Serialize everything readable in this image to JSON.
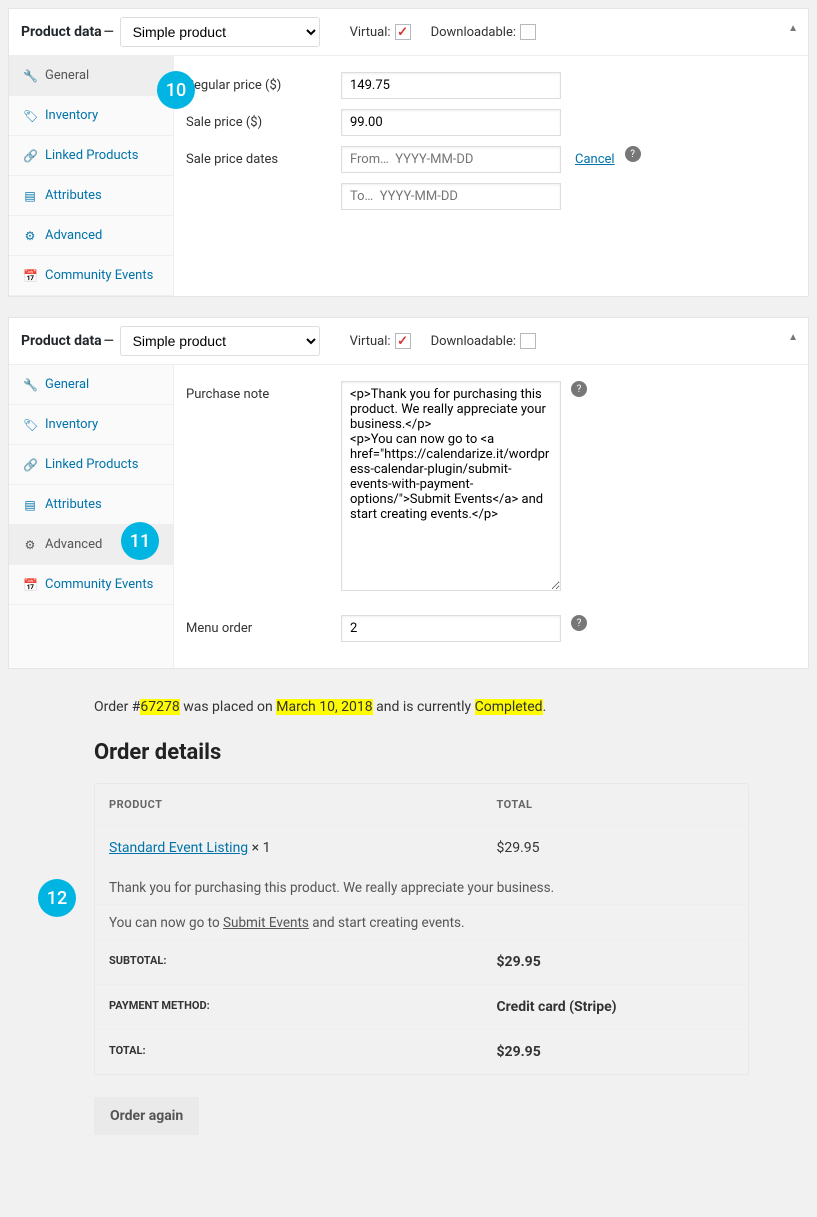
{
  "panel1": {
    "title": "Product data",
    "sep": "—",
    "product_type": "Simple product",
    "virtual_label": "Virtual:",
    "downloadable_label": "Downloadable:",
    "badge": "10",
    "tabs": {
      "general": "General",
      "inventory": "Inventory",
      "linked": "Linked Products",
      "attributes": "Attributes",
      "advanced": "Advanced",
      "events": "Community Events"
    },
    "fields": {
      "regular_label": "Regular price ($)",
      "regular_value": "149.75",
      "sale_label": "Sale price ($)",
      "sale_value": "99.00",
      "dates_label": "Sale price dates",
      "from_placeholder": "From…  YYYY-MM-DD",
      "to_placeholder": "To…  YYYY-MM-DD",
      "cancel": "Cancel"
    }
  },
  "panel2": {
    "title": "Product data",
    "sep": "—",
    "product_type": "Simple product",
    "virtual_label": "Virtual:",
    "downloadable_label": "Downloadable:",
    "badge": "11",
    "tabs": {
      "general": "General",
      "inventory": "Inventory",
      "linked": "Linked Products",
      "attributes": "Attributes",
      "advanced": "Advanced",
      "events": "Community Events"
    },
    "fields": {
      "note_label": "Purchase note",
      "note_value": "<p>Thank you for purchasing this product. We really appreciate your business.</p>\n<p>You can now go to <a href=\"https://calendarize.it/wordpress-calendar-plugin/submit-events-with-payment-options/\">Submit Events</a> and start creating events.</p>",
      "menu_label": "Menu order",
      "menu_value": "2"
    }
  },
  "order": {
    "badge": "12",
    "line_pre": "Order #",
    "number": "67278",
    "line_mid1": " was placed on ",
    "date": "March 10, 2018",
    "line_mid2": " and is currently ",
    "status": "Completed",
    "line_end": ".",
    "details_title": "Order details",
    "col_product": "PRODUCT",
    "col_total": "TOTAL",
    "item_name": "Standard Event Listing",
    "item_qty": " × 1",
    "item_total": "$29.95",
    "note1": "Thank you for purchasing this product. We really appreciate your business.",
    "note2_pre": "You can now go to ",
    "note2_link": "Submit Events",
    "note2_post": " and start creating events.",
    "subtotal_label": "SUBTOTAL:",
    "subtotal": "$29.95",
    "pm_label": "PAYMENT METHOD:",
    "pm": "Credit card (Stripe)",
    "total_label": "TOTAL:",
    "total": "$29.95",
    "order_again": "Order again"
  }
}
